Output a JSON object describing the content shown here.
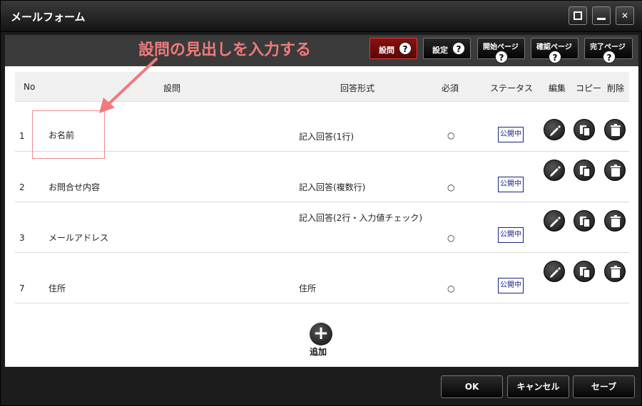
{
  "window": {
    "title": "メールフォーム"
  },
  "toolbar": {
    "tabs": [
      {
        "label": "設問",
        "active": true
      },
      {
        "label": "設定",
        "active": false
      },
      {
        "label": "開始ページ",
        "active": false
      },
      {
        "label": "確認ページ",
        "active": false
      },
      {
        "label": "完了ページ",
        "active": false
      }
    ],
    "help_glyph": "?"
  },
  "annotation": "設問の見出しを入力する",
  "table": {
    "columns": [
      "No",
      "設問",
      "回答形式",
      "必須",
      "ステータス",
      "編集",
      "コピー",
      "削除"
    ],
    "rows": [
      {
        "no": "1",
        "question": "お名前",
        "format": "記入回答(1行)",
        "required": "○",
        "status": "公開中"
      },
      {
        "no": "2",
        "question": "お問合せ内容",
        "format": "記入回答(複数行)",
        "required": "○",
        "status": "公開中"
      },
      {
        "no": "3",
        "question": "メールアドレス",
        "format": "記入回答(2行・入力値チェック)",
        "required": "○",
        "status": "公開中"
      },
      {
        "no": "7",
        "question": "住所",
        "format": "住所",
        "required": "○",
        "status": "公開中"
      }
    ]
  },
  "add": {
    "glyph": "+",
    "label": "追加"
  },
  "footer": {
    "ok": "OK",
    "cancel": "キャンセル",
    "save": "セーブ"
  },
  "colors": {
    "accent": "#f07a7a",
    "active_tab": "#8a1212",
    "status": "#1a237e"
  }
}
